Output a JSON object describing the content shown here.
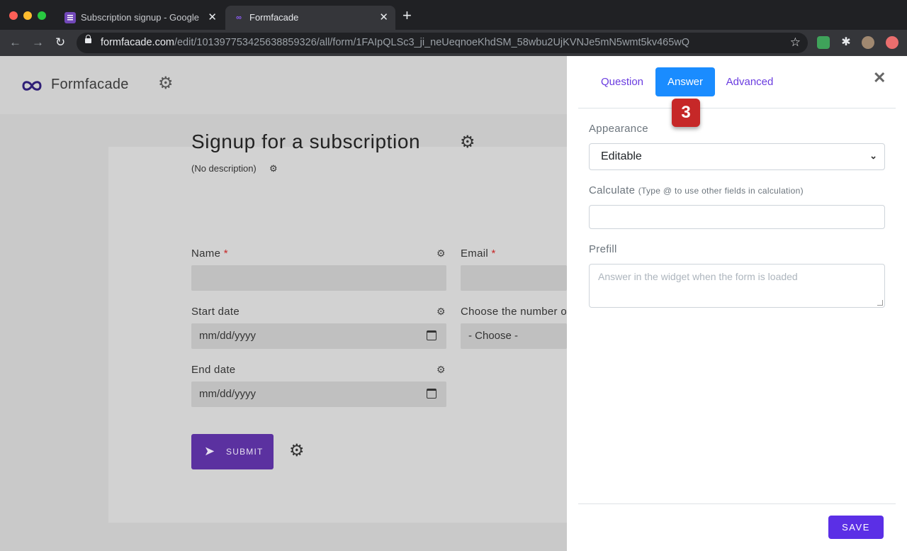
{
  "browser": {
    "tabs": [
      {
        "title": "Subscription signup - Google F"
      },
      {
        "title": "Formfacade"
      }
    ],
    "url_host": "formfacade.com",
    "url_path": "/edit/101397753425638859326/all/form/1FAIpQLSc3_ji_neUeqnoeKhdSM_58wbu2UjKVNJe5mN5wmt5kv465wQ"
  },
  "app": {
    "brand": "Formfacade"
  },
  "form": {
    "title": "Signup for a subscription",
    "description": "(No description)",
    "fields": {
      "name_label": "Name",
      "email_label": "Email",
      "required_mark": "*",
      "start_label": "Start date",
      "choose_label": "Choose the number o",
      "end_label": "End date",
      "date_placeholder": "mm/dd/yyyy",
      "choose_value": "- Choose -"
    },
    "submit_label": "SUBMIT"
  },
  "panel": {
    "tabs": {
      "question": "Question",
      "answer": "Answer",
      "advanced": "Advanced"
    },
    "step_badge": "3",
    "appearance_label": "Appearance",
    "appearance_value": "Editable",
    "calculate_label": "Calculate",
    "calculate_hint": "(Type @ to use other fields in calculation)",
    "prefill_label": "Prefill",
    "prefill_placeholder": "Answer in the widget when the form is loaded",
    "save_label": "SAVE"
  },
  "colors": {
    "accent_purple": "#5b31a0",
    "active_tab_blue": "#1a8cff",
    "step_badge_red": "#c62828"
  },
  "icons": {
    "gear": "gear-icon",
    "close": "close-icon",
    "send": "send-icon",
    "calendar": "calendar-icon"
  }
}
